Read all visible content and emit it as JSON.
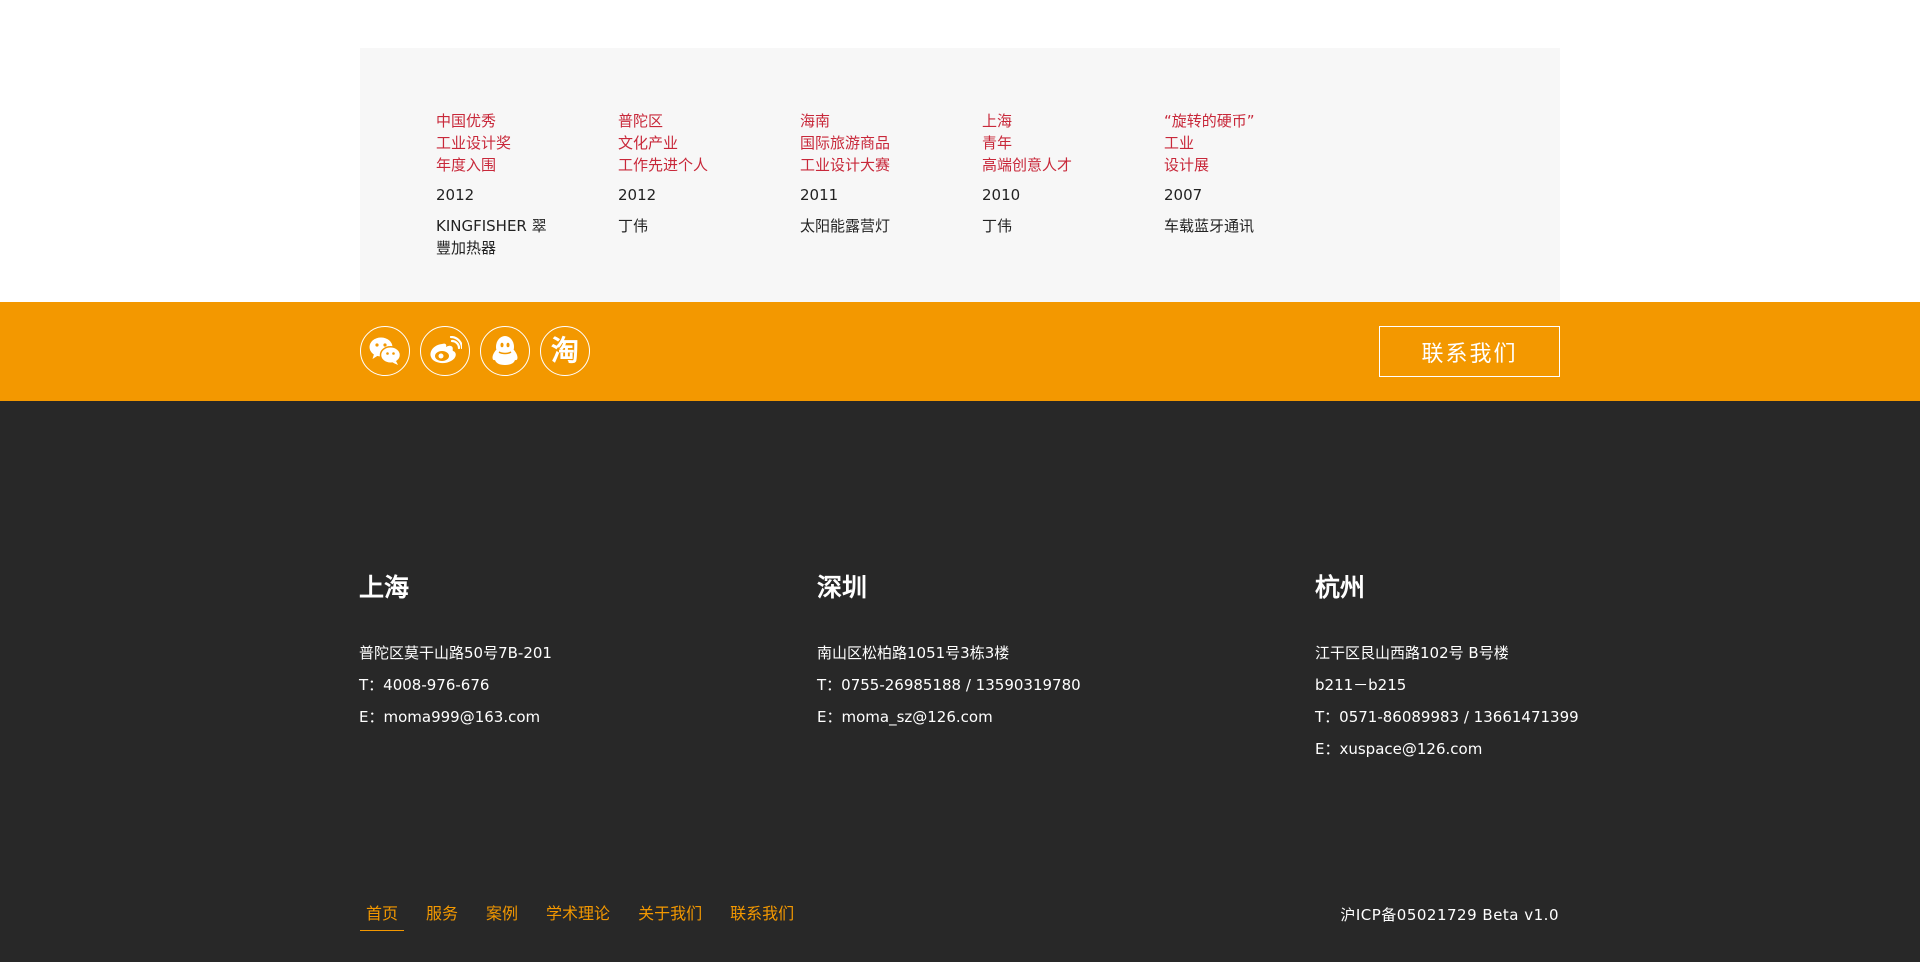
{
  "awards": [
    {
      "title": [
        "中国优秀",
        "工业设计奖",
        "年度入围"
      ],
      "year": "2012",
      "work": "KINGFISHER 翠豐加热器"
    },
    {
      "title": [
        "普陀区",
        "文化产业",
        "工作先进个人"
      ],
      "year": "2012",
      "work": "丁伟"
    },
    {
      "title": [
        "海南",
        "国际旅游商品",
        "工业设计大赛"
      ],
      "year": "2011",
      "work": "太阳能露营灯"
    },
    {
      "title": [
        "上海",
        "青年",
        "高端创意人才"
      ],
      "year": "2010",
      "work": "丁伟"
    },
    {
      "title": [
        "“旋转的硬币”",
        "工业",
        "设计展"
      ],
      "year": "2007",
      "work": "车载蓝牙通讯"
    }
  ],
  "social": {
    "icons": [
      "wechat-icon",
      "weibo-icon",
      "qq-icon",
      "taobao-icon"
    ],
    "taobao_glyph": "淘",
    "contact_button": "联系我们"
  },
  "offices": [
    {
      "city": "上海",
      "lines": [
        "普陀区莫干山路50号7B-201",
        "T：4008-976-676",
        "E：moma999@163.com"
      ]
    },
    {
      "city": "深圳",
      "lines": [
        "南山区松柏路1051号3栋3楼",
        "T：0755-26985188 / 13590319780",
        "E：moma_sz@126.com"
      ]
    },
    {
      "city": "杭州",
      "lines": [
        "江干区艮山西路102号 B号楼",
        "b211－b215",
        "T：0571-86089983 / 13661471399",
        "E：xuspace@126.com"
      ]
    }
  ],
  "nav": [
    "首页",
    "服务",
    "案例",
    "学术理论",
    "关于我们",
    "联系我们"
  ],
  "icp": "沪ICP备05021729 Beta v1.0",
  "colors": {
    "accent": "#f39800",
    "award_title": "#c8283a",
    "footer_bg": "#282828",
    "panel_bg": "#f7f7f7"
  }
}
